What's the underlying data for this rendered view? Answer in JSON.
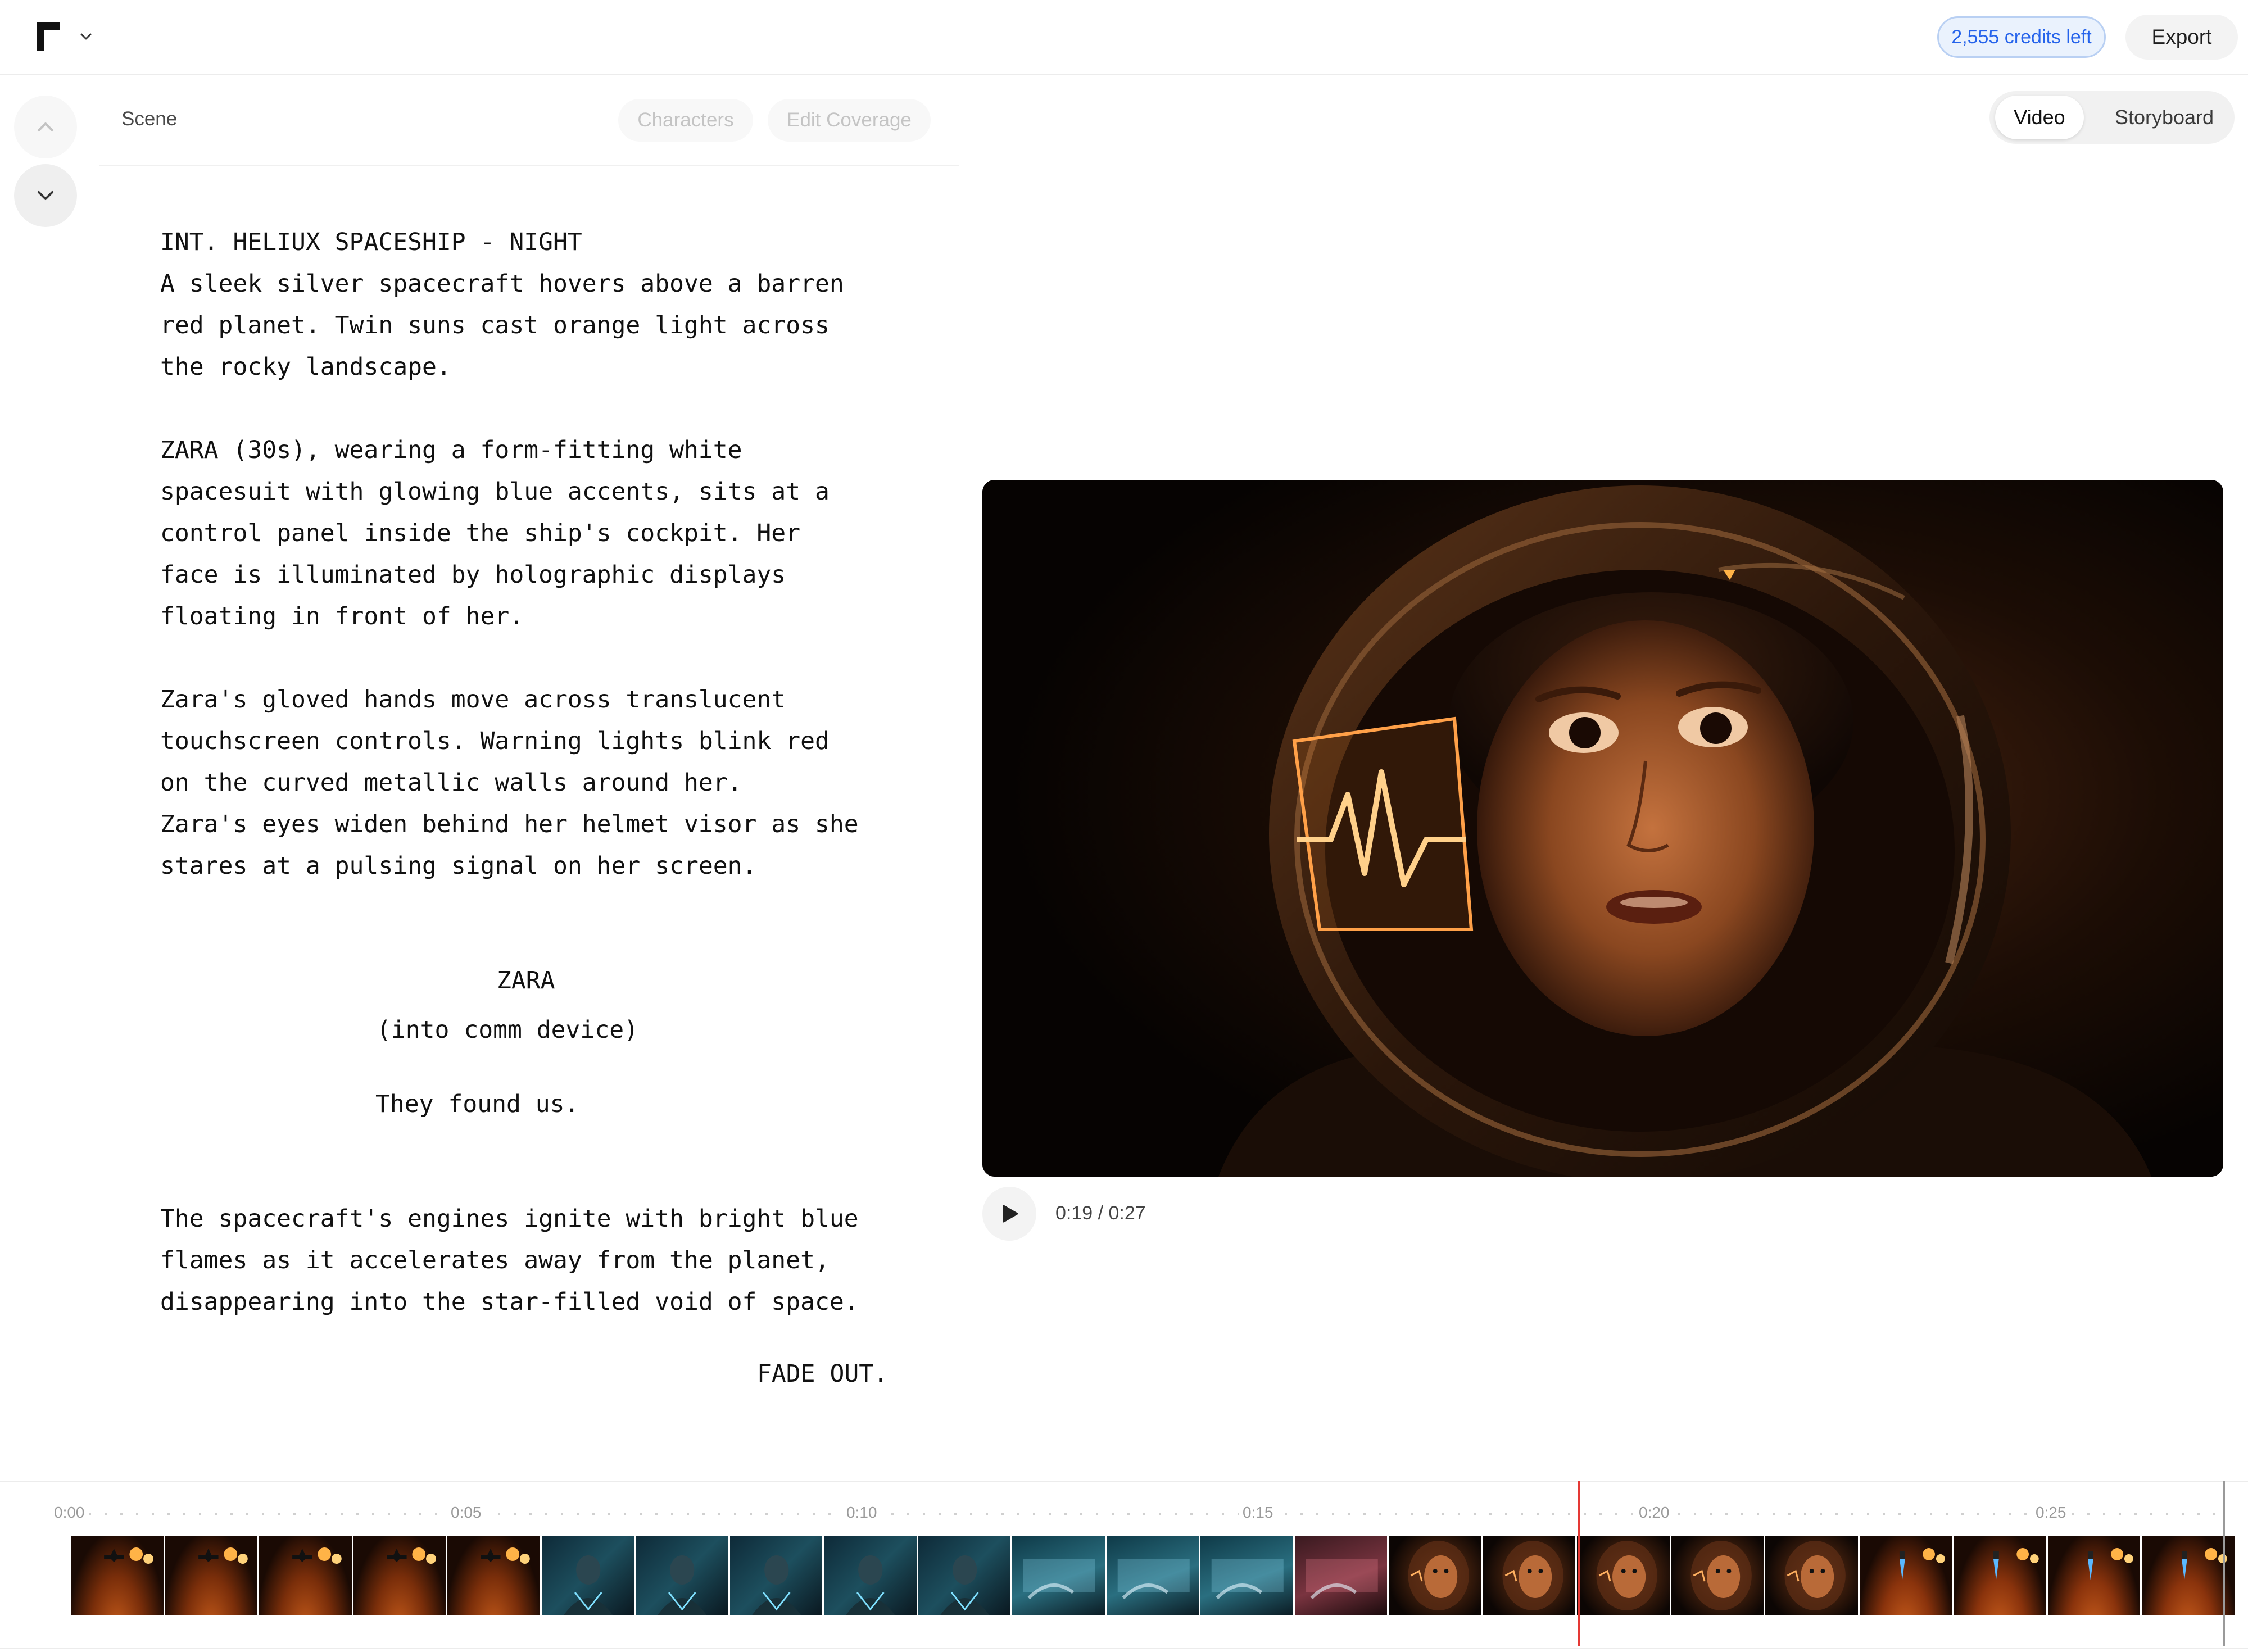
{
  "header": {
    "credits_label": "2,555 credits left",
    "export_label": "Export"
  },
  "scene_panel": {
    "scene_label": "Scene",
    "tabs": [
      {
        "label": "Characters",
        "state": "disabled"
      },
      {
        "label": "Edit Coverage",
        "state": "disabled"
      }
    ]
  },
  "view_toggle": {
    "options": [
      {
        "label": "Video",
        "selected": true
      },
      {
        "label": "Storyboard",
        "selected": false
      }
    ]
  },
  "screenplay": {
    "action_lines": [
      "INT. HELIUX SPACESHIP - NIGHT",
      "A sleek silver spacecraft hovers above a barren",
      "red planet. Twin suns cast orange light across",
      "the rocky landscape.",
      "ZARA (30s), wearing a form-fitting white",
      "spacesuit with glowing blue accents, sits at a",
      "control panel inside the ship's cockpit. Her",
      "face is illuminated by holographic displays",
      "floating in front of her.",
      "Zara's gloved hands move across translucent",
      "touchscreen controls. Warning lights blink red",
      "on the curved metallic walls around her.",
      "Zara's eyes widen behind her helmet visor as she",
      "stares at a pulsing signal on her screen."
    ],
    "character": "ZARA",
    "parenthetical": "(into comm device)",
    "dialogue": "They found us.",
    "closing_lines": [
      "The spacecraft's engines ignite with bright blue",
      "flames as it accelerates away from the planet,",
      "disappearing into the star-filled void of space."
    ],
    "transition": "FADE OUT."
  },
  "player": {
    "time_readout": "0:19 / 0:27",
    "current_seconds": 19,
    "duration_seconds": 27
  },
  "timeline": {
    "tick_labels": [
      "0:00",
      "0:05",
      "0:10",
      "0:15",
      "0:20",
      "0:25"
    ],
    "playhead_seconds": 19,
    "thumbnails": [
      "planet-ship",
      "planet-ship",
      "planet-ship",
      "planet-ship",
      "planet-ship",
      "cockpit-blue",
      "cockpit-blue",
      "cockpit-blue",
      "cockpit-blue",
      "cockpit-blue",
      "hands-controls",
      "hands-controls",
      "hands-controls",
      "hands-red",
      "helmet-face",
      "helmet-face",
      "helmet-face",
      "helmet-face",
      "helmet-face",
      "ship-flames",
      "ship-flames",
      "ship-flames",
      "ship-flames"
    ]
  },
  "colors": {
    "accent_blue": "#2563eb",
    "playhead_red": "#e53935",
    "video_glow": "#ff9a3c"
  }
}
